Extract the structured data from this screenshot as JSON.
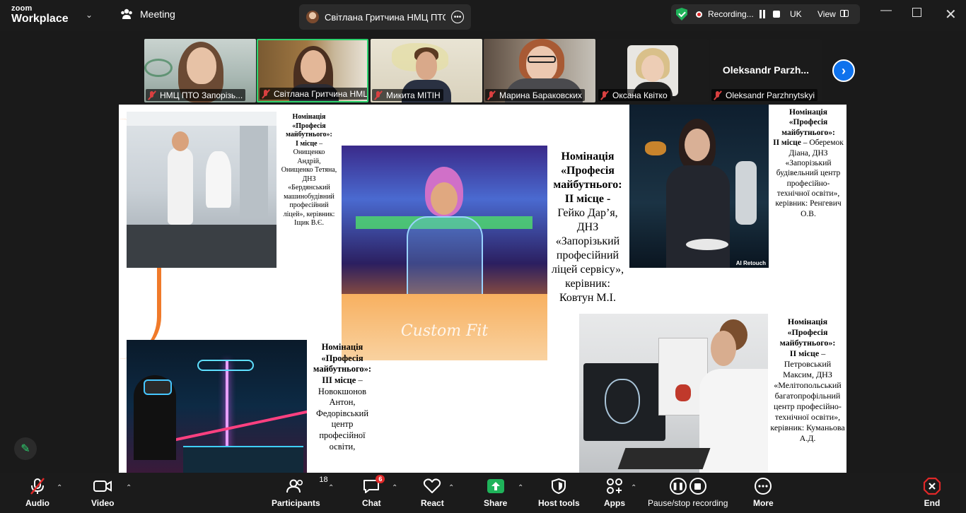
{
  "app": {
    "brand_small": "zoom",
    "brand_large": "Workplace",
    "meeting_label": "Meeting",
    "active_speaker": "Світлана Гритчина НМЦ ПТО у З",
    "recording_label": "Recording...",
    "language": "UK",
    "view_label": "View"
  },
  "participants": [
    {
      "name": "НМЦ ПТО Запорізь...",
      "muted": true
    },
    {
      "name": "Світлана Гритчина НМЦ...",
      "muted": true,
      "active": true
    },
    {
      "name": "Микита МІТІН",
      "muted": true
    },
    {
      "name": "Марина Бараковских",
      "muted": true
    },
    {
      "name": "Оксана Квітко",
      "muted": true
    },
    {
      "name": "Oleksandr Parzhnytskyi",
      "display_name": "Oleksandr  Parzh...",
      "muted": true
    }
  ],
  "slide": {
    "cap1": {
      "nomination": "Номінація «Професія майбутнього»:",
      "place": "І місце",
      "text": "– Онищенко Андрій, Онищенко Тетяна, ДНЗ «Бердянський машинобудівний професійний ліцей», керівник: Іщик В.Є."
    },
    "cap2": {
      "nomination": "Номінація «Професія майбутнього:",
      "place": "ІІ місце -",
      "text": "Гейко Дар’я, ДНЗ «Запорізький професійний ліцей сервісу», керівник: Ковтун М.І."
    },
    "cap3": {
      "nomination": "Номінація «Професія майбутнього»:",
      "place": "ІІ місце",
      "text": "– Оберемок Діана, ДНЗ «Запорізький будівельний центр професійно-технічної освіти», керівник: Ренгевич О.В."
    },
    "cap4": {
      "nomination": "Номінація «Професія майбутнього»:",
      "place": "ІІІ місце",
      "text": "– Новокшонов Антон, Федорівський центр професійної освіти,"
    },
    "cap5": {
      "nomination": "Номінація «Професія майбутнього»:",
      "place": "ІІ місце",
      "text": "– Петровський Максим, ДНЗ «Мелітопольський багатопрофільний центр професійно-технічної освіти», керівник: Куманьова А.Д."
    },
    "image_text_custom_fit": "Custom Fit",
    "image_text_ai": "AI Retouch"
  },
  "toolbar": {
    "audio": "Audio",
    "video": "Video",
    "participants": "Participants",
    "participants_count": "18",
    "chat": "Chat",
    "chat_badge": "6",
    "react": "React",
    "share": "Share",
    "host_tools": "Host tools",
    "apps": "Apps",
    "pause_stop": "Pause/stop recording",
    "more": "More",
    "end": "End"
  },
  "colors": {
    "accent_green": "#2dd36f",
    "share_green": "#1fb35a",
    "end_red": "#e02828",
    "blue": "#0e72ed"
  }
}
